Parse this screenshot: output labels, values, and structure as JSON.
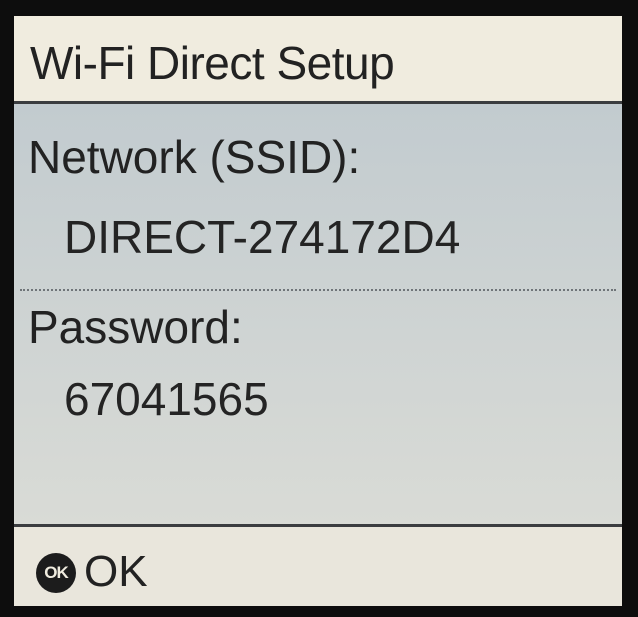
{
  "screen": {
    "title": "Wi-Fi Direct Setup"
  },
  "network": {
    "label": "Network (SSID):",
    "value": "DIRECT-274172D4"
  },
  "password": {
    "label": "Password:",
    "value": "67041565"
  },
  "footer": {
    "ok_icon_text": "OK",
    "ok_label": "OK"
  },
  "colors": {
    "bezel": "#0d0d0d",
    "title_bar": "#f0ecdf",
    "content": "#c9cfcf",
    "text": "#222222"
  }
}
